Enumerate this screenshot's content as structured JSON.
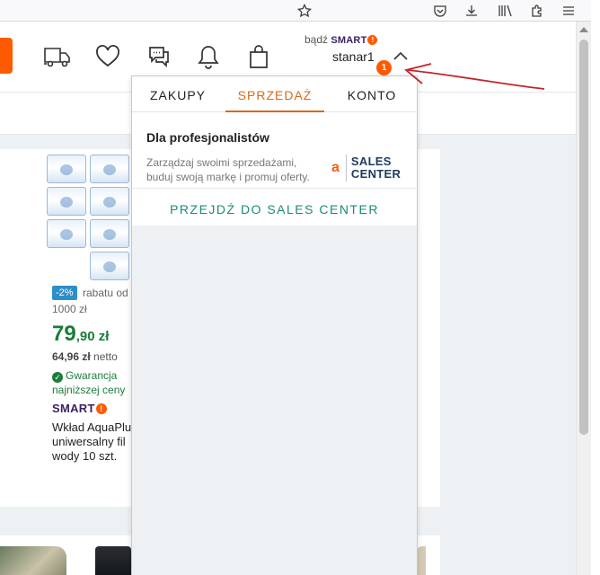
{
  "header": {
    "badz_prefix": "bądź",
    "smart_label": "SMART",
    "smart_mark": "!",
    "username": "stanar1",
    "notification_count": "1"
  },
  "dropdown": {
    "tabs": [
      "ZAKUPY",
      "SPRZEDAŻ",
      "KONTO"
    ],
    "active_tab": "SPRZEDAŻ",
    "title": "Dla profesjonalistów",
    "description": "Zarządzaj swoimi sprzedażami, buduj swoją markę i promuj oferty.",
    "logo_letter": "a",
    "logo_line1": "SALES",
    "logo_line2": "CENTER",
    "link_label": "PRZEJDŹ DO SALES CENTER"
  },
  "product": {
    "discount": "-2%",
    "discount_text": "rabatu od",
    "threshold": "1000 zł",
    "price_main": "79",
    "price_cents": ",90 zł",
    "netto_value": "64,96 zł",
    "netto_label": "netto",
    "guarantee": "Gwarancja najniższej ceny",
    "smart_label": "SMART",
    "title_lines": [
      "Wkład AquaPlu",
      "uniwersalny fil",
      "wody 10 szt."
    ]
  },
  "colors": {
    "brand_orange": "#ff5a00",
    "active_tab": "#d9691a",
    "price_green": "#1a7d3a",
    "link_teal": "#1b8a7a",
    "smart_purple": "#3a2265"
  }
}
